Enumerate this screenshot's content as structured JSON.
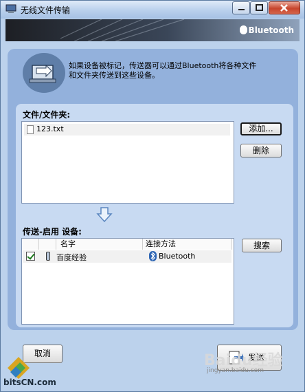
{
  "window": {
    "title": "无线文件传输",
    "brand": "Bluetooth"
  },
  "header": {
    "description_line1": "如果设备被标记，传送器可以通过Bluetooth将各种文件",
    "description_line2": "和文件夹传送到这些设备。"
  },
  "files": {
    "label": "文件/文件夹:",
    "items": [
      {
        "name": "123.txt"
      }
    ],
    "add_label": "添加...",
    "delete_label": "删除"
  },
  "devices": {
    "label": "传送-启用 设备:",
    "columns": [
      "名字",
      "连接方法"
    ],
    "rows": [
      {
        "name": "百度经验",
        "method": "Bluetooth",
        "checked": true
      }
    ],
    "search_label": "搜索"
  },
  "footer": {
    "cancel_label": "取消",
    "send_label": "发送"
  },
  "watermarks": {
    "bits": "bitsCN.com",
    "baidu": "Baidu经验",
    "url": "jingyan.baidu.com"
  },
  "colors": {
    "panel": "#93b1dc",
    "inner": "#c8daf2",
    "banner": "#1d1f24"
  },
  "icons": {
    "title": "app-window-icon",
    "header": "file-transfer-icon",
    "arrow": "arrow-down-icon",
    "bluetooth": "bluetooth-icon"
  }
}
